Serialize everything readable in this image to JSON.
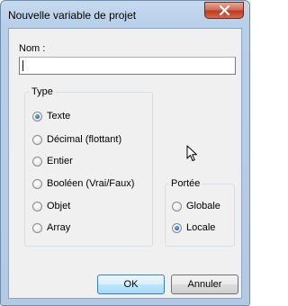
{
  "window": {
    "title": "Nouvelle variable de projet"
  },
  "name_field": {
    "label": "Nom :",
    "value": ""
  },
  "type_group": {
    "title": "Type",
    "options": [
      {
        "label": "Texte",
        "selected": true
      },
      {
        "label": "Décimal (flottant)",
        "selected": false
      },
      {
        "label": "Entier",
        "selected": false
      },
      {
        "label": "Booléen (Vrai/Faux)",
        "selected": false
      },
      {
        "label": "Objet",
        "selected": false
      },
      {
        "label": "Array",
        "selected": false
      }
    ]
  },
  "scope_group": {
    "title": "Portée",
    "options": [
      {
        "label": "Globale",
        "selected": false
      },
      {
        "label": "Locale",
        "selected": true
      }
    ]
  },
  "buttons": {
    "ok": "OK",
    "cancel": "Annuler"
  },
  "icons": {
    "close": "close-icon",
    "cursor": "mouse-pointer-icon"
  },
  "colors": {
    "title_bar": "#c6d9ef",
    "close_button": "#c0391f",
    "client_bg": "#f0f0f0",
    "radio_selected": "#2463c0"
  }
}
